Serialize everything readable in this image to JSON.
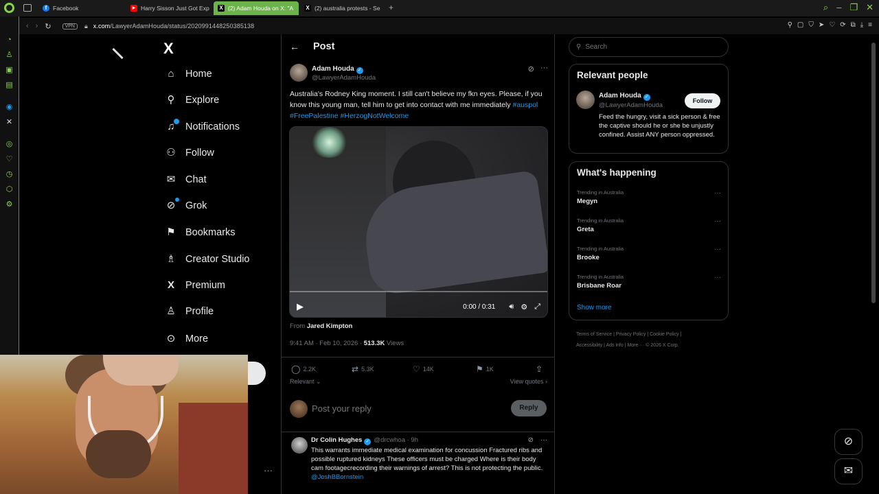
{
  "browser": {
    "tabs": [
      {
        "label": "Facebook",
        "color": "#1877f2",
        "glyph": "f"
      },
      {
        "label": "Harry Sisson Just Got Exp",
        "color": "#ff0000",
        "glyph": "▶"
      },
      {
        "label": "(2) Adam Houda on X: \"A",
        "color": "#000000",
        "glyph": "X"
      },
      {
        "label": "(2) australia protests - Se",
        "color": "#000000",
        "glyph": "X"
      }
    ],
    "url_host": "x.com",
    "url_path": "/LawyerAdamHouda/status/2020991448250385138",
    "vpn_label": "VPN"
  },
  "nav": {
    "logo": "X",
    "items": [
      {
        "label": "Home",
        "icon": "home-icon"
      },
      {
        "label": "Explore",
        "icon": "search-icon"
      },
      {
        "label": "Notifications",
        "icon": "bell-icon"
      },
      {
        "label": "Follow",
        "icon": "person-plus-icon"
      },
      {
        "label": "Chat",
        "icon": "mail-icon"
      },
      {
        "label": "Grok",
        "icon": "grok-icon"
      },
      {
        "label": "Bookmarks",
        "icon": "bookmark-icon"
      },
      {
        "label": "Creator Studio",
        "icon": "creator-icon"
      },
      {
        "label": "Premium",
        "icon": "x-icon"
      },
      {
        "label": "Profile",
        "icon": "person-icon"
      },
      {
        "label": "More",
        "icon": "more-circle-icon"
      }
    ]
  },
  "post": {
    "header_title": "Post",
    "author_name": "Adam Houda",
    "author_handle": "@LawyerAdamHouda",
    "text": "Australia's Rodney King moment. I still can't believe my fkn eyes. Please, if you know this young man, tell him to get into contact with me immediately ",
    "hashtags": [
      "#auspol",
      "#FreePalestine",
      "#HerzogNotWelcome"
    ],
    "video_time": "0:00 / 0:31",
    "from_label": "From",
    "from_name": "Jared Kimpton",
    "timestamp": "9:41 AM · Feb 10, 2026 · ",
    "views_count": "513.3K",
    "views_label": "Views",
    "replies": "2.2K",
    "reposts": "5.3K",
    "likes": "14K",
    "bookmarks": "1K",
    "sort_label": "Relevant",
    "view_quotes": "View quotes"
  },
  "reply": {
    "placeholder": "Post your reply",
    "button": "Reply"
  },
  "comment": {
    "name": "Dr Colin Hughes",
    "handle": "@drcwhoa · 9h",
    "text": "This warrants immediate medical examination for concussion Fractured ribs and possible ruptured kidneys These officers must be charged Where is their body cam footagecrecording their warnings of arrest? This is not protecting the public. ",
    "mention": "@JoshBBornstein"
  },
  "sidebar": {
    "search_placeholder": "Search",
    "relevant_title": "Relevant people",
    "rp_name": "Adam Houda",
    "rp_handle": "@LawyerAdamHouda",
    "follow_label": "Follow",
    "rp_bio": "Feed the hungry, visit a sick person & free the captive should he or she be unjustly confined. Assist ANY person oppressed.",
    "happening_title": "What's happening",
    "trends": [
      {
        "category": "Trending in Australia",
        "name": "Megyn"
      },
      {
        "category": "Trending in Australia",
        "name": "Greta"
      },
      {
        "category": "Trending in Australia",
        "name": "Brooke"
      },
      {
        "category": "Trending in Australia",
        "name": "Brisbane Roar"
      }
    ],
    "show_more": "Show more",
    "footer_line1": "Terms of Service  |  Privacy Policy  |  Cookie Policy  |",
    "footer_line2": "Accessibility  |  Ads info  |  More ···  © 2026 X Corp."
  },
  "colors": {
    "accent": "#1d9bf0",
    "opera_green": "#8ad24a",
    "active_tab": "#6bb34a"
  }
}
